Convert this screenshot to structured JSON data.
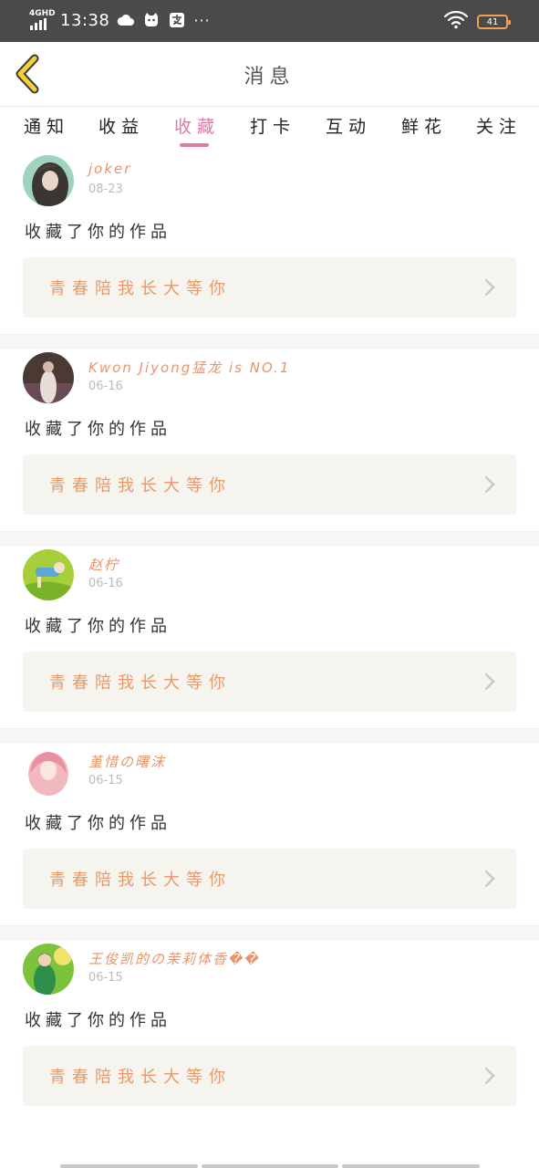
{
  "status_bar": {
    "network": "4GHD",
    "time": "13:38",
    "dots": "···",
    "battery": "41",
    "icons": [
      "cloud-icon",
      "cat-icon",
      "alipay-icon",
      "wifi-icon",
      "battery-icon"
    ]
  },
  "header": {
    "title": "消息",
    "back_icon": "chevron-left-icon",
    "accent_color": "#f3d033"
  },
  "tabs": [
    {
      "label": "通知",
      "active": false
    },
    {
      "label": "收益",
      "active": false
    },
    {
      "label": "收藏",
      "active": true
    },
    {
      "label": "打卡",
      "active": false
    },
    {
      "label": "互动",
      "active": false
    },
    {
      "label": "鲜花",
      "active": false
    },
    {
      "label": "关注",
      "active": false
    }
  ],
  "active_color": "#e078a8",
  "feed": [
    {
      "name": "joker",
      "date": "08-23",
      "action": "收藏了你的作品",
      "work_title": "青春陪我长大等你"
    },
    {
      "name": "Kwon Jiyong猛龙 is NO.1",
      "date": "06-16",
      "action": "收藏了你的作品",
      "work_title": "青春陪我长大等你"
    },
    {
      "name": "赵柠",
      "date": "06-16",
      "action": "收藏了你的作品",
      "work_title": "青春陪我长大等你"
    },
    {
      "name": "堇惜の曙沫",
      "date": "06-15",
      "action": "收藏了你的作品",
      "work_title": "青春陪我长大等你"
    },
    {
      "name": "王俊凯的の茉莉体香��",
      "date": "06-15",
      "action": "收藏了你的作品",
      "work_title": "青春陪我长大等你"
    }
  ],
  "colors": {
    "name": "#e8956a",
    "work_box": "#f5f4ee",
    "status_bar": "#4a4a4a"
  }
}
